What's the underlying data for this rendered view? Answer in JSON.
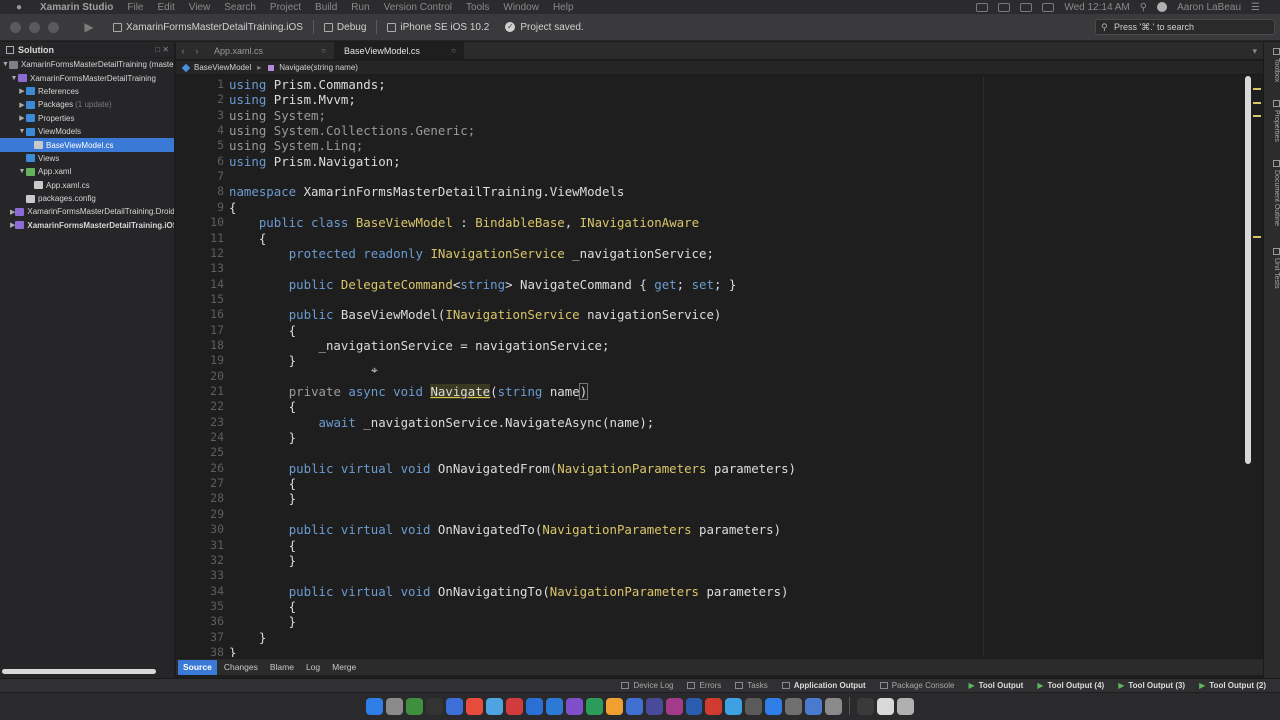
{
  "menubar": {
    "app": "Xamarin Studio",
    "menus": [
      "File",
      "Edit",
      "View",
      "Search",
      "Project",
      "Build",
      "Run",
      "Version Control",
      "Tools",
      "Window",
      "Help"
    ],
    "clock": "Wed 12:14 AM",
    "user": "Aaron LaBeau"
  },
  "toolbar": {
    "project": "XamarinFormsMasterDetailTraining.iOS",
    "configuration": "Debug",
    "device": "iPhone SE iOS 10.2",
    "status": "Project saved.",
    "search_placeholder": "Press '⌘.' to search"
  },
  "solution": {
    "header": "Solution",
    "items": [
      {
        "label": "XamarinFormsMasterDetailTraining (master)",
        "meta": "",
        "icon": "sol",
        "depth": 0,
        "arrow": "▼",
        "selected": false,
        "bold": false
      },
      {
        "label": "XamarinFormsMasterDetailTraining",
        "meta": "",
        "icon": "proj",
        "depth": 1,
        "arrow": "▼",
        "selected": false,
        "bold": false
      },
      {
        "label": "References",
        "meta": "",
        "icon": "folder",
        "depth": 2,
        "arrow": "▶",
        "selected": false,
        "bold": false
      },
      {
        "label": "Packages",
        "meta": "(1 update)",
        "icon": "folder",
        "depth": 2,
        "arrow": "▶",
        "selected": false,
        "bold": false
      },
      {
        "label": "Properties",
        "meta": "",
        "icon": "folder",
        "depth": 2,
        "arrow": "▶",
        "selected": false,
        "bold": false
      },
      {
        "label": "ViewModels",
        "meta": "",
        "icon": "folder",
        "depth": 2,
        "arrow": "▼",
        "selected": false,
        "bold": false
      },
      {
        "label": "BaseViewModel.cs",
        "meta": "",
        "icon": "file",
        "depth": 3,
        "arrow": "",
        "selected": true,
        "bold": false
      },
      {
        "label": "Views",
        "meta": "",
        "icon": "folder",
        "depth": 2,
        "arrow": "",
        "selected": false,
        "bold": false
      },
      {
        "label": "App.xaml",
        "meta": "",
        "icon": "xaml",
        "depth": 2,
        "arrow": "▼",
        "selected": false,
        "bold": false
      },
      {
        "label": "App.xaml.cs",
        "meta": "",
        "icon": "file",
        "depth": 3,
        "arrow": "",
        "selected": false,
        "bold": false
      },
      {
        "label": "packages.config",
        "meta": "",
        "icon": "file",
        "depth": 2,
        "arrow": "",
        "selected": false,
        "bold": false
      },
      {
        "label": "XamarinFormsMasterDetailTraining.Droid",
        "meta": "",
        "icon": "proj",
        "depth": 1,
        "arrow": "▶",
        "selected": false,
        "bold": false
      },
      {
        "label": "XamarinFormsMasterDetailTraining.iOS",
        "meta": "",
        "icon": "proj",
        "depth": 1,
        "arrow": "▶",
        "selected": false,
        "bold": true
      }
    ]
  },
  "tabs": [
    {
      "label": "App.xaml.cs",
      "active": false
    },
    {
      "label": "BaseViewModel.cs",
      "active": true
    }
  ],
  "breadcrumb": [
    "BaseViewModel",
    "Navigate(string name)"
  ],
  "code_lines": [
    [
      [
        "kw",
        "using"
      ],
      [
        "t",
        " Prism.Commands;"
      ]
    ],
    [
      [
        "kw",
        "using"
      ],
      [
        "t",
        " Prism.Mvvm;"
      ]
    ],
    [
      [
        "dim",
        "using System;"
      ]
    ],
    [
      [
        "dim",
        "using System.Collections.Generic;"
      ]
    ],
    [
      [
        "dim",
        "using System.Linq;"
      ]
    ],
    [
      [
        "kw",
        "using"
      ],
      [
        "t",
        " Prism.Navigation;"
      ]
    ],
    [],
    [
      [
        "kw",
        "namespace"
      ],
      [
        "t",
        " XamarinFormsMasterDetailTraining.ViewModels"
      ]
    ],
    [
      [
        "t",
        "{"
      ]
    ],
    [
      [
        "t",
        "    "
      ],
      [
        "kw",
        "public class"
      ],
      [
        "t",
        " "
      ],
      [
        "ty",
        "BaseViewModel"
      ],
      [
        "t",
        " : "
      ],
      [
        "ty",
        "BindableBase"
      ],
      [
        "t",
        ", "
      ],
      [
        "ty",
        "INavigationAware"
      ]
    ],
    [
      [
        "t",
        "    {"
      ]
    ],
    [
      [
        "t",
        "        "
      ],
      [
        "kw",
        "protected readonly"
      ],
      [
        "t",
        " "
      ],
      [
        "ty",
        "INavigationService"
      ],
      [
        "t",
        " _navigationService;"
      ]
    ],
    [],
    [
      [
        "t",
        "        "
      ],
      [
        "kw",
        "public"
      ],
      [
        "t",
        " "
      ],
      [
        "ty",
        "DelegateCommand"
      ],
      [
        "t",
        "<"
      ],
      [
        "kw",
        "string"
      ],
      [
        "t",
        "> NavigateCommand { "
      ],
      [
        "kw",
        "get"
      ],
      [
        "t",
        "; "
      ],
      [
        "kw",
        "set"
      ],
      [
        "t",
        "; }"
      ]
    ],
    [],
    [
      [
        "t",
        "        "
      ],
      [
        "kw",
        "public"
      ],
      [
        "t",
        " BaseViewModel("
      ],
      [
        "ty",
        "INavigationService"
      ],
      [
        "t",
        " navigationService)"
      ]
    ],
    [
      [
        "t",
        "        {"
      ]
    ],
    [
      [
        "t",
        "            _navigationService = navigationService;"
      ]
    ],
    [
      [
        "t",
        "        }"
      ]
    ],
    [],
    [
      [
        "t",
        "        "
      ],
      [
        "dim",
        "private"
      ],
      [
        "t",
        " "
      ],
      [
        "kw",
        "async void"
      ],
      [
        "t",
        " "
      ],
      [
        "hl",
        "Navigate"
      ],
      [
        "t",
        "("
      ],
      [
        "kw",
        "string"
      ],
      [
        "t",
        " name"
      ],
      [
        "br",
        ")"
      ]
    ],
    [
      [
        "t",
        "        {"
      ]
    ],
    [
      [
        "t",
        "            "
      ],
      [
        "kw",
        "await"
      ],
      [
        "t",
        " _navigationService.NavigateAsync(name);"
      ]
    ],
    [
      [
        "t",
        "        }"
      ]
    ],
    [],
    [
      [
        "t",
        "        "
      ],
      [
        "kw",
        "public virtual void"
      ],
      [
        "t",
        " OnNavigatedFrom("
      ],
      [
        "ty",
        "NavigationParameters"
      ],
      [
        "t",
        " parameters)"
      ]
    ],
    [
      [
        "t",
        "        {"
      ]
    ],
    [
      [
        "t",
        "        }"
      ]
    ],
    [],
    [
      [
        "t",
        "        "
      ],
      [
        "kw",
        "public virtual void"
      ],
      [
        "t",
        " OnNavigatedTo("
      ],
      [
        "ty",
        "NavigationParameters"
      ],
      [
        "t",
        " parameters)"
      ]
    ],
    [
      [
        "t",
        "        {"
      ]
    ],
    [
      [
        "t",
        "        }"
      ]
    ],
    [],
    [
      [
        "t",
        "        "
      ],
      [
        "kw",
        "public virtual void"
      ],
      [
        "t",
        " OnNavigatingTo("
      ],
      [
        "ty",
        "NavigationParameters"
      ],
      [
        "t",
        " parameters)"
      ]
    ],
    [
      [
        "t",
        "        {"
      ]
    ],
    [
      [
        "t",
        "        }"
      ]
    ],
    [
      [
        "t",
        "    }"
      ]
    ],
    [
      [
        "t",
        "}"
      ]
    ]
  ],
  "right_dock": [
    "Toolbox",
    "Properties",
    "Document Outline",
    "Unit Tests"
  ],
  "source_tabs": [
    {
      "label": "Source",
      "active": true
    },
    {
      "label": "Changes",
      "active": false
    },
    {
      "label": "Blame",
      "active": false
    },
    {
      "label": "Log",
      "active": false
    },
    {
      "label": "Merge",
      "active": false
    }
  ],
  "status_pads": [
    {
      "label": "Device Log",
      "kind": "pad"
    },
    {
      "label": "Errors",
      "kind": "pad"
    },
    {
      "label": "Tasks",
      "kind": "pad"
    },
    {
      "label": "Application Output",
      "kind": "pad-bold"
    },
    {
      "label": "Package Console",
      "kind": "pad"
    },
    {
      "label": "Tool Output",
      "kind": "run"
    },
    {
      "label": "Tool Output (4)",
      "kind": "run"
    },
    {
      "label": "Tool Output (3)",
      "kind": "run"
    },
    {
      "label": "Tool Output (2)",
      "kind": "run"
    }
  ],
  "dock_colors": [
    "#2f7ee8",
    "#8a8a8a",
    "#3f8f3f",
    "#333333",
    "#3c6fd8",
    "#e74c3c",
    "#4fa3e0",
    "#d13b3b",
    "#2a6fd6",
    "#2d7ad6",
    "#7f4fc9",
    "#2b9c5a",
    "#f0a030",
    "#3f6fd0",
    "#4a4a9a",
    "#a33a8a",
    "#2a5db0",
    "#cf3b2f",
    "#3da0e0",
    "#5a5a5a",
    "#2f7ee8",
    "#6f6f6f",
    "#4a7ad0",
    "#8a8a8a",
    "#3a3a3a",
    "#d8d8d8",
    "#b0b0b0"
  ]
}
